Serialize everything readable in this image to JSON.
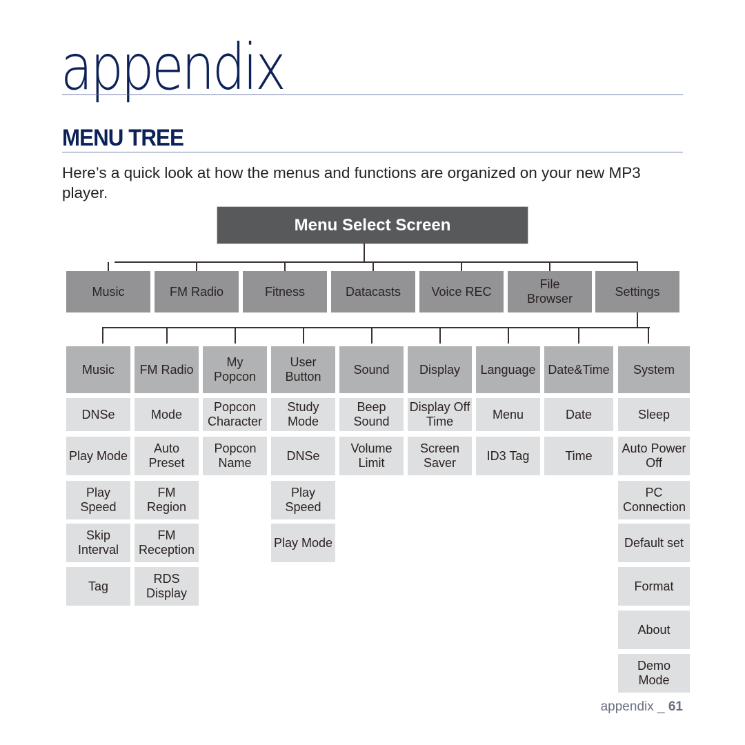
{
  "header": {
    "chapter_title": "appendix",
    "section_title": "MENU TREE",
    "intro": "Here’s a quick look at how the menus and functions are organized on your new MP3 player."
  },
  "tree": {
    "root": "Menu Select Screen",
    "level1": [
      "Music",
      "FM Radio",
      "Fitness",
      "Datacasts",
      "Voice REC",
      "File Browser",
      "Settings"
    ],
    "settings_children": [
      {
        "label": "Music",
        "items": [
          "DNSe",
          "Play Mode",
          "Play Speed",
          "Skip Interval",
          "Tag"
        ]
      },
      {
        "label": "FM Radio",
        "items": [
          "Mode",
          "Auto Preset",
          "FM Region",
          "FM Reception",
          "RDS Display"
        ]
      },
      {
        "label": "My Popcon",
        "items": [
          "Popcon Character",
          "Popcon Name"
        ]
      },
      {
        "label": "User Button",
        "items": [
          "Study Mode",
          "DNSe",
          "Play Speed",
          "Play Mode"
        ]
      },
      {
        "label": "Sound",
        "items": [
          "Beep Sound",
          "Volume Limit"
        ]
      },
      {
        "label": "Display",
        "items": [
          "Display Off Time",
          "Screen Saver"
        ]
      },
      {
        "label": "Language",
        "items": [
          "Menu",
          "ID3 Tag"
        ]
      },
      {
        "label": "Date&Time",
        "items": [
          "Date",
          "Time"
        ]
      },
      {
        "label": "System",
        "items": [
          "Sleep",
          "Auto Power Off",
          "PC Connection",
          "Default set",
          "Format",
          "About",
          "Demo Mode"
        ]
      }
    ]
  },
  "footer": {
    "section": "appendix _",
    "page_number": "61"
  }
}
